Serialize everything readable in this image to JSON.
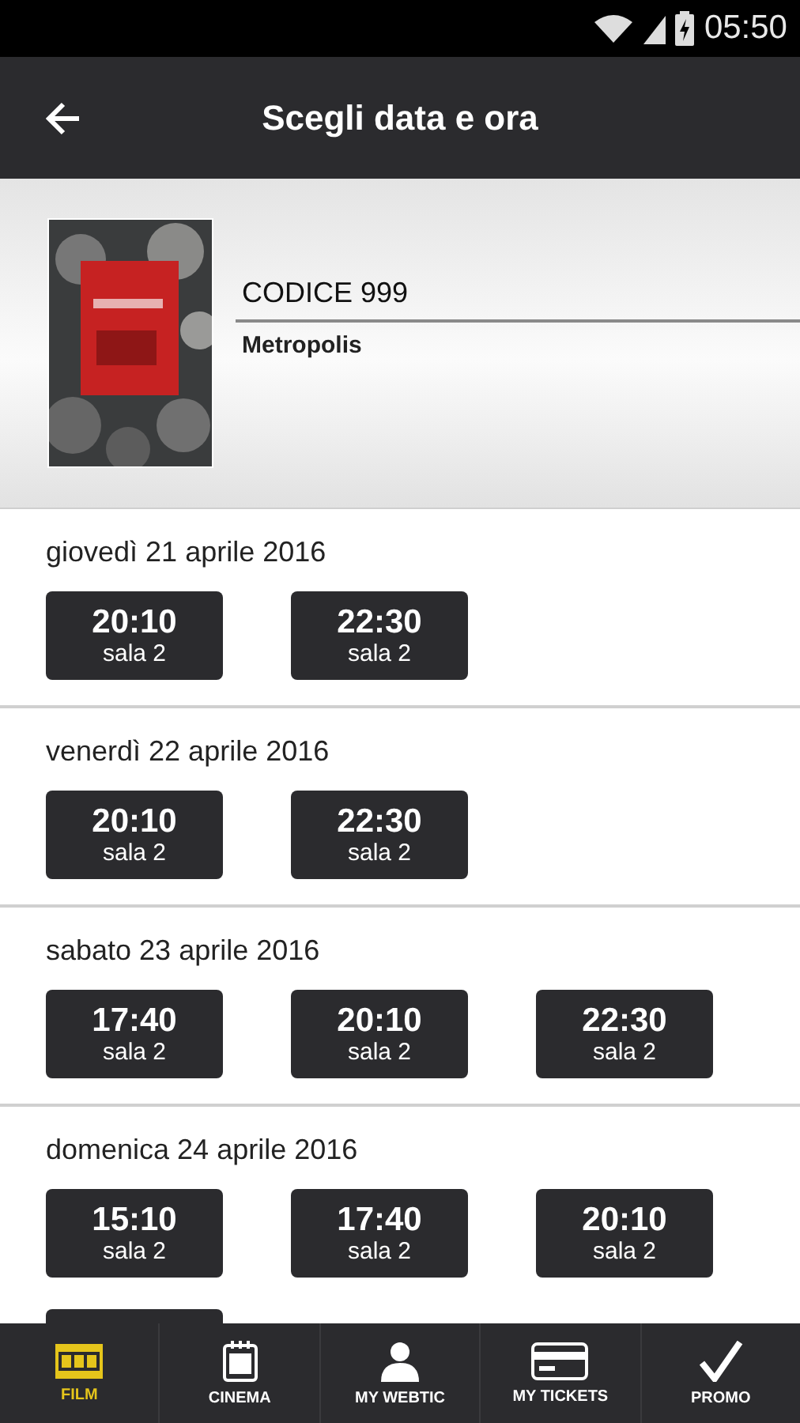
{
  "status_bar": {
    "time": "05:50"
  },
  "app_bar": {
    "title": "Scegli data e ora"
  },
  "movie": {
    "title": "CODICE 999",
    "cinema": "Metropolis"
  },
  "days": [
    {
      "date": "giovedì 21 aprile 2016",
      "shows": [
        {
          "time": "20:10",
          "room": "sala 2"
        },
        {
          "time": "22:30",
          "room": "sala 2"
        }
      ]
    },
    {
      "date": "venerdì 22 aprile 2016",
      "shows": [
        {
          "time": "20:10",
          "room": "sala 2"
        },
        {
          "time": "22:30",
          "room": "sala 2"
        }
      ]
    },
    {
      "date": "sabato 23 aprile 2016",
      "shows": [
        {
          "time": "17:40",
          "room": "sala 2"
        },
        {
          "time": "20:10",
          "room": "sala 2"
        },
        {
          "time": "22:30",
          "room": "sala 2"
        }
      ]
    },
    {
      "date": "domenica 24 aprile 2016",
      "shows": [
        {
          "time": "15:10",
          "room": "sala 2"
        },
        {
          "time": "17:40",
          "room": "sala 2"
        },
        {
          "time": "20:10",
          "room": "sala 2"
        },
        {
          "kind": "cut_off"
        }
      ]
    }
  ],
  "bottom_nav": [
    {
      "kind": "film",
      "label": "FILM",
      "selected": true
    },
    {
      "kind": "calendar",
      "label": "CINEMA",
      "selected": false
    },
    {
      "kind": "person",
      "label": "MY WEBTIC",
      "selected": false
    },
    {
      "kind": "card",
      "label": "MY TICKETS",
      "selected": false
    },
    {
      "kind": "check",
      "label": "PROMO",
      "selected": false
    }
  ]
}
